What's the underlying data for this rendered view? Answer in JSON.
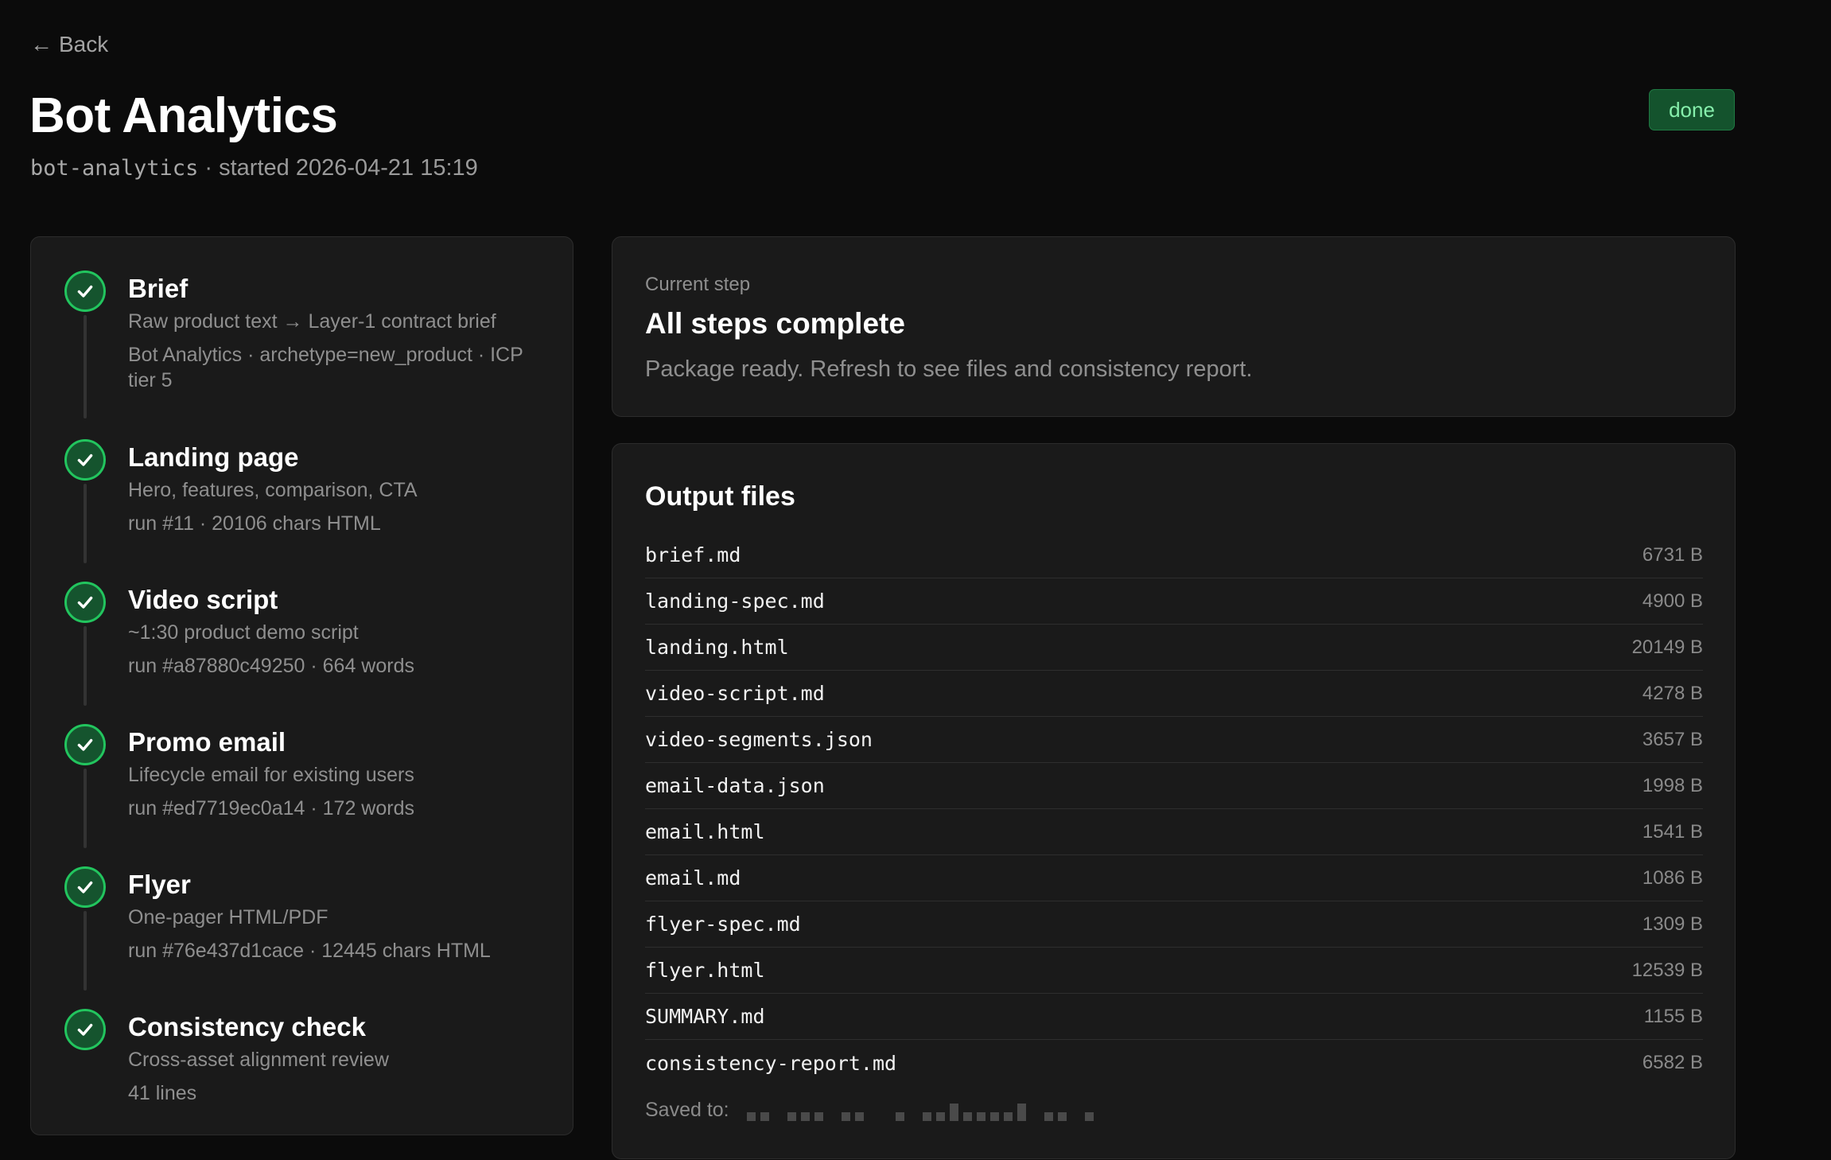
{
  "nav": {
    "back_label": "Back"
  },
  "header": {
    "title": "Bot Analytics",
    "slug": "bot-analytics",
    "started": "· started 2026-04-21 15:19",
    "status": "done"
  },
  "steps": [
    {
      "name": "Brief",
      "desc": "Raw product text → Layer-1 contract brief",
      "meta": "Bot Analytics · archetype=new_product · ICP tier 5",
      "done": true
    },
    {
      "name": "Landing page",
      "desc": "Hero, features, comparison, CTA",
      "meta": "run #11 · 20106 chars HTML",
      "done": true
    },
    {
      "name": "Video script",
      "desc": "~1:30 product demo script",
      "meta": "run #a87880c49250 · 664 words",
      "done": true
    },
    {
      "name": "Promo email",
      "desc": "Lifecycle email for existing users",
      "meta": "run #ed7719ec0a14 · 172 words",
      "done": true
    },
    {
      "name": "Flyer",
      "desc": "One-pager HTML/PDF",
      "meta": "run #76e437d1cace · 12445 chars HTML",
      "done": true
    },
    {
      "name": "Consistency check",
      "desc": "Cross-asset alignment review",
      "meta": "41 lines",
      "done": true
    }
  ],
  "current_step": {
    "label": "Current step",
    "heading": "All steps complete",
    "text": "Package ready. Refresh to see files and consistency report."
  },
  "outputs": {
    "heading": "Output files",
    "files": [
      {
        "name": "brief.md",
        "size": "6731 B"
      },
      {
        "name": "landing-spec.md",
        "size": "4900 B"
      },
      {
        "name": "landing.html",
        "size": "20149 B"
      },
      {
        "name": "video-script.md",
        "size": "4278 B"
      },
      {
        "name": "video-segments.json",
        "size": "3657 B"
      },
      {
        "name": "email-data.json",
        "size": "1998 B"
      },
      {
        "name": "email.html",
        "size": "1541 B"
      },
      {
        "name": "email.md",
        "size": "1086 B"
      },
      {
        "name": "flyer-spec.md",
        "size": "1309 B"
      },
      {
        "name": "flyer.html",
        "size": "12539 B"
      },
      {
        "name": "SUMMARY.md",
        "size": "1155 B"
      },
      {
        "name": "consistency-report.md",
        "size": "6582 B"
      }
    ],
    "saved_label": "Saved to:"
  },
  "colors": {
    "background": "#0b0b0b",
    "panel": "#1a1a1a",
    "success": "#22c55e",
    "badge_bg": "#14532d"
  }
}
